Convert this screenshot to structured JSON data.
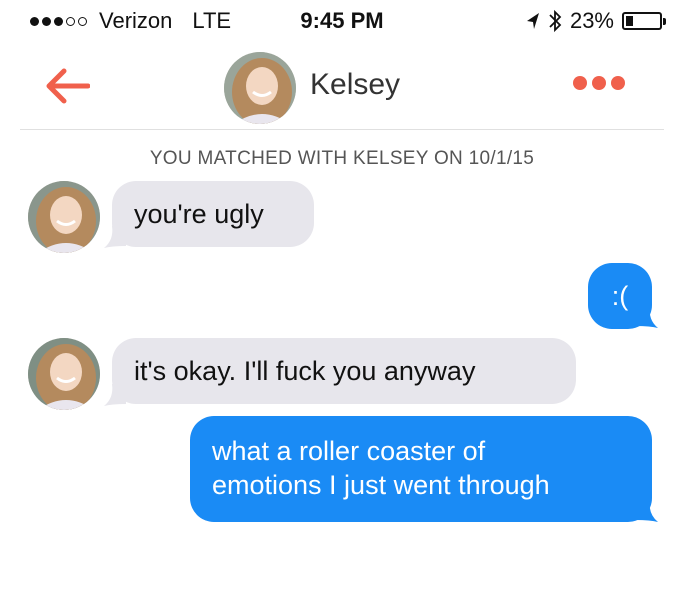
{
  "status_bar": {
    "carrier": "Verizon",
    "network": "LTE",
    "time": "9:45 PM",
    "battery": "23%",
    "battery_level": 0.23,
    "signal_bars_filled": 3,
    "signal_bars_total": 5
  },
  "header": {
    "contact_name": "Kelsey"
  },
  "match_notice": "YOU MATCHED WITH KELSEY ON 10/1/15",
  "messages": [
    {
      "from": "them",
      "text": "you're ugly"
    },
    {
      "from": "me",
      "text": ":("
    },
    {
      "from": "them",
      "text": "it's okay. I'll fuck you anyway"
    },
    {
      "from": "me",
      "line1": "what a roller coaster of",
      "line2": "emotions I just went through"
    }
  ],
  "colors": {
    "accent": "#f0604c",
    "outgoing_bubble": "#1a8bf5",
    "incoming_bubble": "#e7e6ec"
  }
}
